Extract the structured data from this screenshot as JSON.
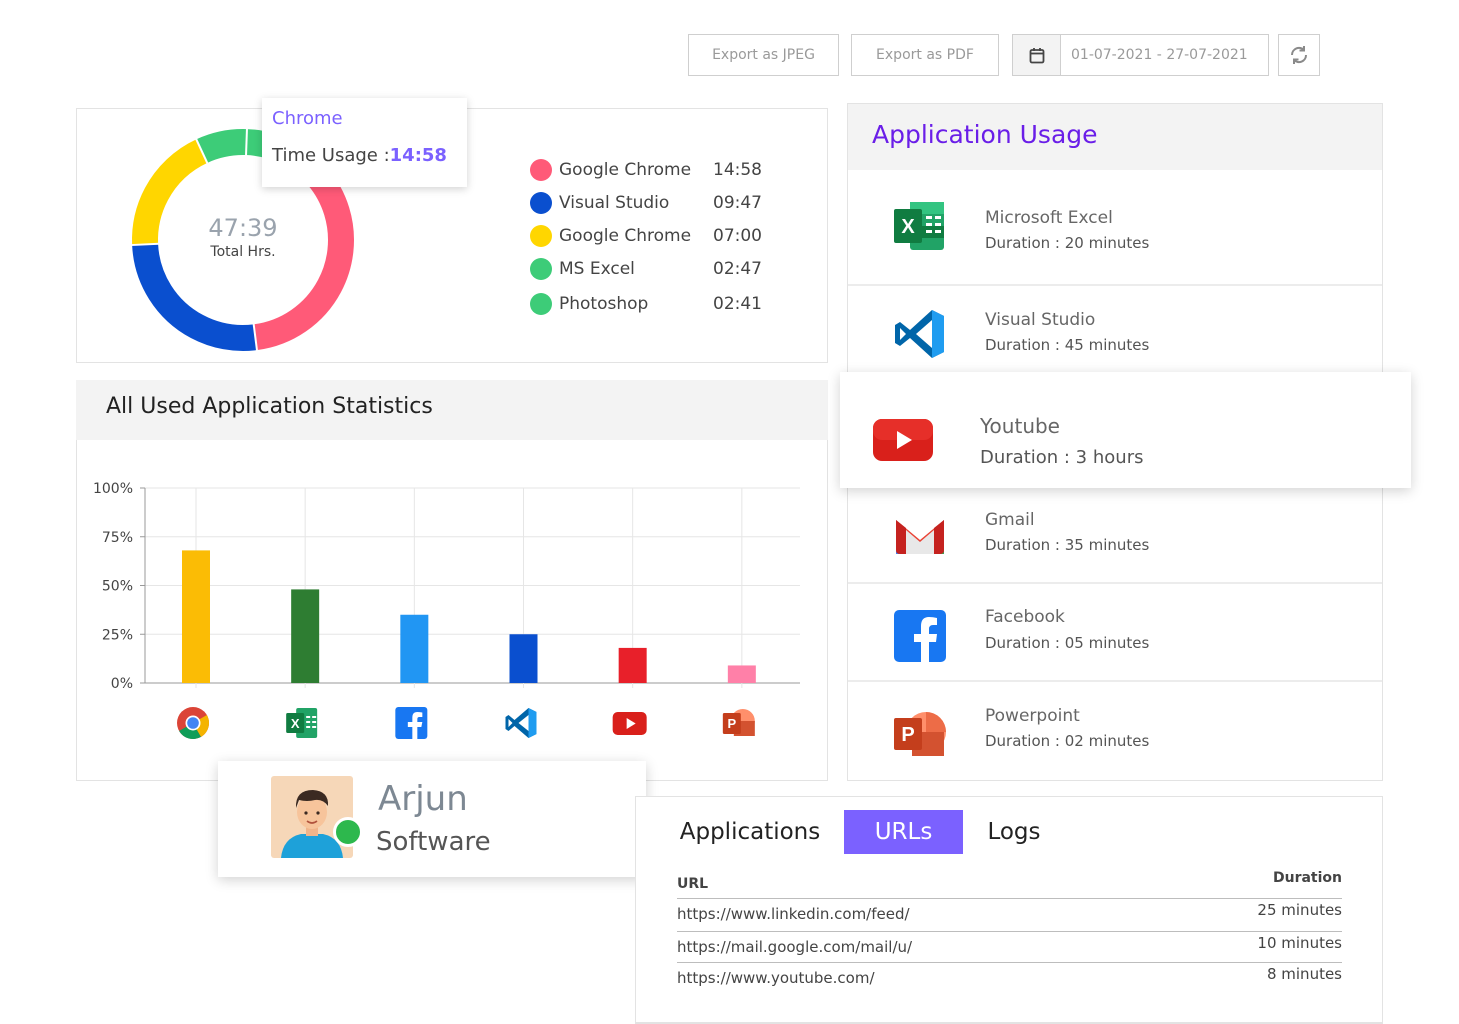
{
  "toolbar": {
    "export_jpeg": "Export as JPEG",
    "export_pdf": "Export as PDF",
    "date_range": "01-07-2021 - 27-07-2021"
  },
  "donut": {
    "total_value": "47:39",
    "total_label": "Total Hrs.",
    "tooltip": {
      "app": "Chrome",
      "label": "Time Usage :",
      "value": "14:58"
    },
    "legend": [
      {
        "name": "Google Chrome",
        "time": "14:58",
        "color": "#ff5a78"
      },
      {
        "name": "Visual Studio",
        "time": "09:47",
        "color": "#0a4fcf"
      },
      {
        "name": "Google Chrome",
        "time": "07:00",
        "color": "#ffd600"
      },
      {
        "name": "MS Excel",
        "time": "02:47",
        "color": "#3dcc78"
      },
      {
        "name": "Photoshop",
        "time": "02:41",
        "color": "#3dcc78"
      }
    ]
  },
  "stats": {
    "title": "All Used Application Statistics"
  },
  "chart_data": {
    "type": "bar",
    "categories": [
      "Chrome",
      "Excel",
      "Facebook",
      "Visual Studio",
      "YouTube",
      "PowerPoint"
    ],
    "values": [
      68,
      48,
      35,
      25,
      18,
      9
    ],
    "colors": [
      "#fbbc05",
      "#2e7d32",
      "#2196f3",
      "#0a4fcf",
      "#e8202a",
      "#ff80a8"
    ],
    "yticks": [
      "100%",
      "75%",
      "50%",
      "25%",
      "0%"
    ],
    "ylim": [
      0,
      100
    ],
    "grid": true,
    "icons": [
      "chrome-icon",
      "excel-icon",
      "facebook-icon",
      "vscode-icon",
      "youtube-icon",
      "powerpoint-icon"
    ]
  },
  "usage": {
    "title": "Application Usage",
    "apps": [
      {
        "name": "Microsoft Excel",
        "duration": "Duration : 20 minutes",
        "icon": "excel-icon"
      },
      {
        "name": "Visual Studio",
        "duration": "Duration : 45 minutes",
        "icon": "vscode-icon"
      },
      {
        "name": "Youtube",
        "duration": "Duration : 3 hours",
        "icon": "youtube-icon"
      },
      {
        "name": "Gmail",
        "duration": "Duration : 35 minutes",
        "icon": "gmail-icon"
      },
      {
        "name": "Facebook",
        "duration": "Duration : 05 minutes",
        "icon": "facebook-icon"
      },
      {
        "name": "Powerpoint",
        "duration": "Duration : 02 minutes",
        "icon": "powerpoint-icon"
      }
    ]
  },
  "profile": {
    "name": "Arjun",
    "department": "Software",
    "status_color": "#2db84d"
  },
  "tabs": {
    "items": [
      "Applications",
      "URLs",
      "Logs"
    ],
    "active": "URLs"
  },
  "urls": {
    "col_url": "URL",
    "col_duration": "Duration",
    "rows": [
      {
        "url": "https://www.linkedin.com/feed/",
        "duration": "25 minutes"
      },
      {
        "url": "https://mail.google.com/mail/u/",
        "duration": "10 minutes"
      },
      {
        "url": "https://www.youtube.com/",
        "duration": "8 minutes"
      }
    ]
  }
}
